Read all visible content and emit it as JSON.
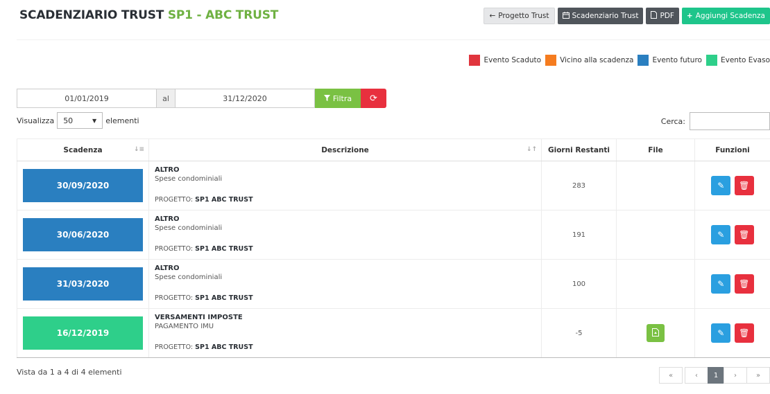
{
  "header": {
    "title_main": "SCADENZIARIO TRUST",
    "title_highlight": "SP1 - ABC TRUST",
    "buttons": [
      {
        "label": "Progetto Trust",
        "icon": "arrow-left-icon"
      },
      {
        "label": "Scadenziario Trust",
        "icon": "calendar-icon"
      },
      {
        "label": "PDF",
        "icon": "pdf-icon"
      },
      {
        "label": "Aggiungi Scadenza",
        "icon": "plus-icon"
      }
    ]
  },
  "legend": [
    {
      "label": "Evento Scaduto",
      "color": "#e0353d"
    },
    {
      "label": "Vicino alla scadenza",
      "color": "#f57c1f"
    },
    {
      "label": "Evento futuro",
      "color": "#2a7fc0"
    },
    {
      "label": "Evento Evaso",
      "color": "#2ecf8a"
    }
  ],
  "filter": {
    "date_from": "01/01/2019",
    "between": "al",
    "date_to": "31/12/2020",
    "filter_label": "Filtra"
  },
  "length": {
    "before": "Visualizza",
    "value": "50",
    "after": "elementi"
  },
  "search": {
    "label": "Cerca:"
  },
  "table": {
    "headers": [
      "Scadenza",
      "Descrizione",
      "Giorni Restanti",
      "File",
      "Funzioni"
    ],
    "rows": [
      {
        "date": "30/09/2020",
        "color": "#2a7fc0",
        "category": "ALTRO",
        "description": "Spese condominiali",
        "project_label": "PROGETTO:",
        "project": "SP1 ABC TRUST",
        "days": "283",
        "has_file": false
      },
      {
        "date": "30/06/2020",
        "color": "#2a7fc0",
        "category": "ALTRO",
        "description": "Spese condominiali",
        "project_label": "PROGETTO:",
        "project": "SP1 ABC TRUST",
        "days": "191",
        "has_file": false
      },
      {
        "date": "31/03/2020",
        "color": "#2a7fc0",
        "category": "ALTRO",
        "description": "Spese condominiali",
        "project_label": "PROGETTO:",
        "project": "SP1 ABC TRUST",
        "days": "100",
        "has_file": false
      },
      {
        "date": "16/12/2019",
        "color": "#2ecf8a",
        "category": "VERSAMENTI IMPOSTE",
        "description": "PAGAMENTO IMU",
        "project_label": "PROGETTO:",
        "project": "SP1 ABC TRUST",
        "days": "-5",
        "has_file": true
      }
    ]
  },
  "footer": {
    "info": "Vista da 1 a 4 di 4 elementi",
    "pages": [
      "«",
      "‹",
      "1",
      "›",
      "»"
    ]
  }
}
